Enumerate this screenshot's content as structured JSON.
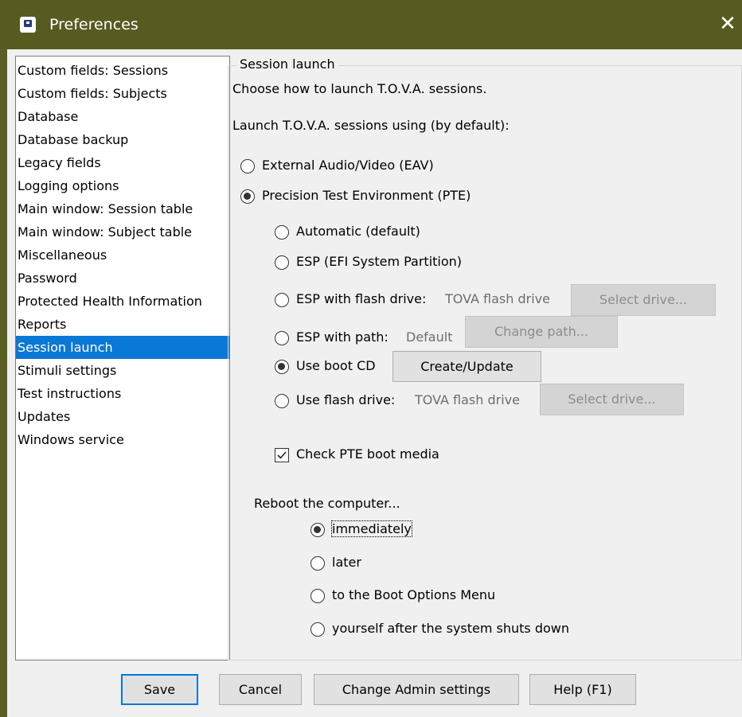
{
  "window": {
    "title": "Preferences",
    "close_glyph": "✕",
    "app_icon": "app-icon"
  },
  "sidebar": {
    "items": [
      {
        "label": "Custom fields: Sessions",
        "selected": false
      },
      {
        "label": "Custom fields: Subjects",
        "selected": false
      },
      {
        "label": "Database",
        "selected": false
      },
      {
        "label": "Database backup",
        "selected": false
      },
      {
        "label": "Legacy fields",
        "selected": false
      },
      {
        "label": "Logging options",
        "selected": false
      },
      {
        "label": "Main window: Session table",
        "selected": false
      },
      {
        "label": "Main window: Subject table",
        "selected": false
      },
      {
        "label": "Miscellaneous",
        "selected": false
      },
      {
        "label": "Password",
        "selected": false
      },
      {
        "label": "Protected Health Information",
        "selected": false
      },
      {
        "label": "Reports",
        "selected": false
      },
      {
        "label": "Session launch",
        "selected": true
      },
      {
        "label": "Stimuli settings",
        "selected": false
      },
      {
        "label": "Test instructions",
        "selected": false
      },
      {
        "label": "Updates",
        "selected": false
      },
      {
        "label": "Windows service",
        "selected": false
      }
    ]
  },
  "panel": {
    "legend": "Session launch",
    "description": "Choose how to launch T.O.V.A. sessions.",
    "launch_prompt": "Launch T.O.V.A. sessions using (by default):",
    "launch_options": {
      "eav": {
        "label": "External Audio/Video (EAV)",
        "checked": false
      },
      "pte": {
        "label": "Precision Test Environment (PTE)",
        "checked": true
      }
    },
    "pte_options": {
      "automatic": {
        "label": "Automatic (default)",
        "checked": false
      },
      "esp": {
        "label": "ESP (EFI System Partition)",
        "checked": false
      },
      "esp_flash": {
        "label": "ESP with flash drive:",
        "value": "TOVA flash drive",
        "button": "Select drive...",
        "checked": false
      },
      "esp_path": {
        "label": "ESP with path:",
        "value": "Default",
        "button": "Change path...",
        "checked": false
      },
      "boot_cd": {
        "label": "Use boot CD",
        "button": "Create/Update",
        "checked": true
      },
      "flash_drive": {
        "label": "Use flash drive:",
        "value": "TOVA flash drive",
        "button": "Select drive...",
        "checked": false
      }
    },
    "check_boot_media": {
      "label": "Check PTE boot media",
      "checked": true
    },
    "reboot_prompt": "Reboot the computer...",
    "reboot_options": {
      "immediately": {
        "label": "immediately",
        "checked": true
      },
      "later": {
        "label": "later",
        "checked": false
      },
      "boot_menu": {
        "label": "to the Boot Options Menu",
        "checked": false
      },
      "shutdown": {
        "label": "yourself after the system shuts down",
        "checked": false
      }
    }
  },
  "footer": {
    "save": "Save",
    "cancel": "Cancel",
    "admin": "Change Admin settings",
    "help": "Help (F1)"
  }
}
